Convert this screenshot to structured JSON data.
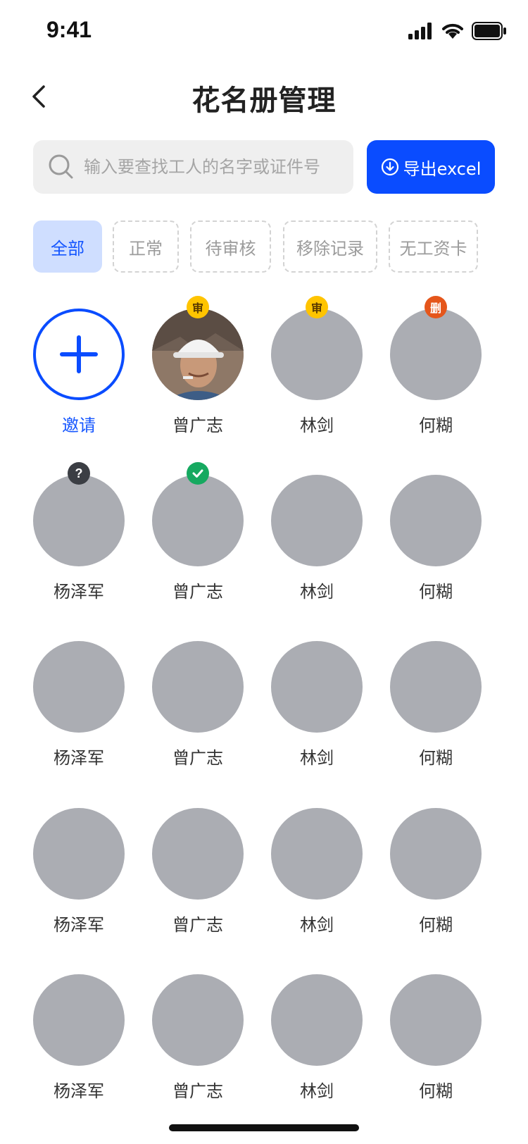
{
  "status": {
    "time": "9:41"
  },
  "header": {
    "title": "花名册管理"
  },
  "search": {
    "placeholder": "输入要查找工人的名字或证件号",
    "export_label": "导出excel"
  },
  "filters": [
    {
      "label": "全部",
      "active": true
    },
    {
      "label": "正常",
      "active": false
    },
    {
      "label": "待审核",
      "active": false
    },
    {
      "label": "移除记录",
      "active": false
    },
    {
      "label": "无工资卡",
      "active": false
    }
  ],
  "invite": {
    "label": "邀请"
  },
  "badges": {
    "review": "审",
    "delete": "删",
    "question": "?"
  },
  "workers": [
    {
      "name": "曾广志",
      "badge": "review",
      "photo": true
    },
    {
      "name": "林剑",
      "badge": "review"
    },
    {
      "name": "何糊",
      "badge": "delete"
    },
    {
      "name": "杨泽军",
      "badge": "question"
    },
    {
      "name": "曾广志",
      "badge": "ok"
    },
    {
      "name": "林剑"
    },
    {
      "name": "何糊"
    },
    {
      "name": "杨泽军"
    },
    {
      "name": "曾广志"
    },
    {
      "name": "林剑"
    },
    {
      "name": "何糊"
    },
    {
      "name": "杨泽军"
    },
    {
      "name": "曾广志"
    },
    {
      "name": "林剑"
    },
    {
      "name": "何糊"
    },
    {
      "name": "杨泽军"
    },
    {
      "name": "曾广志"
    },
    {
      "name": "林剑"
    },
    {
      "name": "何糊"
    }
  ],
  "colors": {
    "accent": "#0a4cff",
    "chip_active_bg": "#cfdeff",
    "avatar_placeholder": "#abadb3",
    "review_badge": "#ffc400",
    "delete_badge": "#e5561b",
    "question_badge": "#3b3e44",
    "ok_badge": "#16a960"
  }
}
